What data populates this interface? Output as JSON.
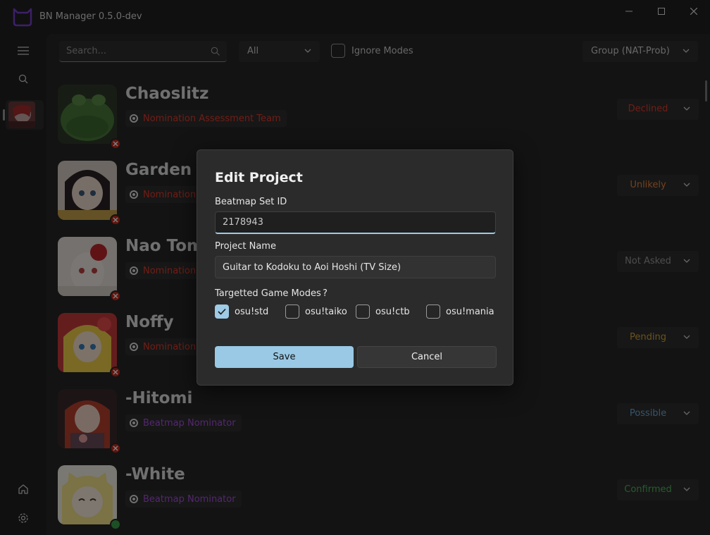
{
  "app": {
    "title": "BN Manager 0.5.0-dev"
  },
  "toolbar": {
    "search_placeholder": "Search...",
    "mode_filter": "All",
    "ignore_modes_label": "Ignore Modes",
    "group_filter": "Group (NAT-Prob)"
  },
  "users": [
    {
      "name": "Chaoslitz",
      "group": "Nomination Assessment Team",
      "status": "Declined",
      "status_color": "#e23b2c"
    },
    {
      "name": "Garden",
      "group": "Nomination Assessment Team",
      "status": "Unlikely",
      "status_color": "#e8833a"
    },
    {
      "name": "Nao Tomori",
      "group": "Nomination Assessment Team",
      "status": "Not Asked",
      "status_color": "#9a9a9a"
    },
    {
      "name": "Noffy",
      "group": "Nomination Assessment Team",
      "status": "Pending",
      "status_color": "#d6a53a"
    },
    {
      "name": "-Hitomi",
      "group": "Beatmap Nominator",
      "status": "Possible",
      "status_color": "#6aa9d6"
    },
    {
      "name": "-White",
      "group": "Beatmap Nominator",
      "status": "Confirmed",
      "status_color": "#4cb85a"
    }
  ],
  "dialog": {
    "title": "Edit Project",
    "beatmap_label": "Beatmap Set ID",
    "beatmap_value": "2178943",
    "project_label": "Project Name",
    "project_value": "Guitar to Kodoku to Aoi Hoshi (TV Size)",
    "modes_label": "Targetted Game Modes",
    "help": "?",
    "modes": [
      {
        "label": "osu!std",
        "checked": true
      },
      {
        "label": "osu!taiko",
        "checked": false
      },
      {
        "label": "osu!ctb",
        "checked": false
      },
      {
        "label": "osu!mania",
        "checked": false
      }
    ],
    "save_label": "Save",
    "cancel_label": "Cancel"
  },
  "colors": {
    "accent": "#99c9e4",
    "nat": "#e23b2c",
    "bn": "#a74fe0",
    "logo": "#7b3fd1"
  }
}
